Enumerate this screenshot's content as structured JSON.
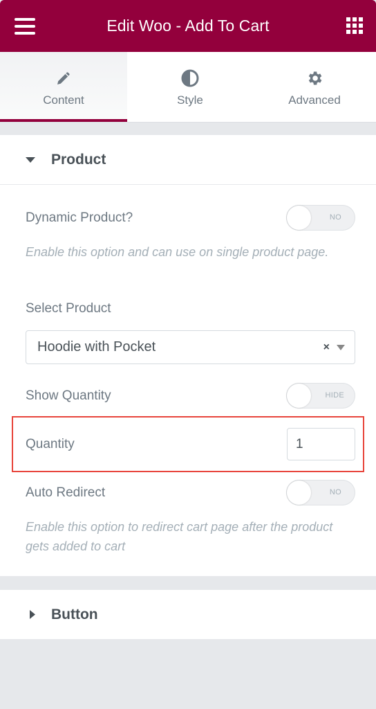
{
  "header": {
    "title": "Edit Woo - Add To Cart",
    "menu_icon": "hamburger-icon",
    "apps_icon": "grid-icon"
  },
  "tabs": [
    {
      "label": "Content",
      "icon": "pencil-icon",
      "active": true
    },
    {
      "label": "Style",
      "icon": "half-circle-icon",
      "active": false
    },
    {
      "label": "Advanced",
      "icon": "gear-icon",
      "active": false
    }
  ],
  "sections": {
    "product": {
      "title": "Product",
      "expanded": true,
      "dynamic_product": {
        "label": "Dynamic Product?",
        "state": "NO",
        "description": "Enable this option and can use on single product page."
      },
      "select_product": {
        "label": "Select Product",
        "value": "Hoodie with Pocket",
        "clear": "×"
      },
      "show_quantity": {
        "label": "Show Quantity",
        "state": "HIDE"
      },
      "quantity": {
        "label": "Quantity",
        "value": "1"
      },
      "auto_redirect": {
        "label": "Auto Redirect",
        "state": "NO",
        "description": "Enable this option to redirect cart page after the product gets added to cart"
      }
    },
    "button": {
      "title": "Button",
      "expanded": false
    }
  },
  "colors": {
    "brand": "#93003c",
    "highlight": "#e8453c"
  }
}
